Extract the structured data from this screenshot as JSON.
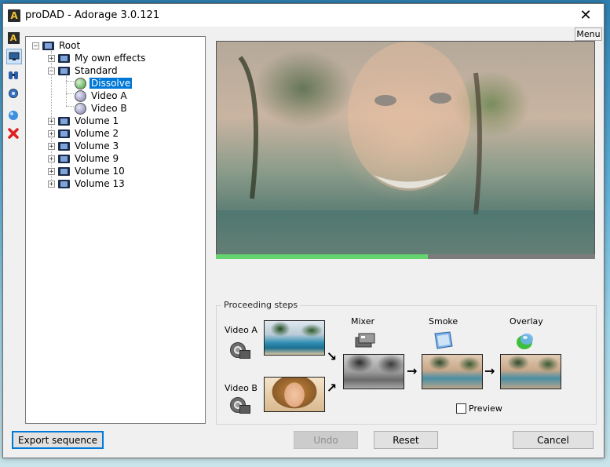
{
  "window": {
    "title": "proDAD - Adorage 3.0.121",
    "close": "✕",
    "menu_label": "Menu"
  },
  "tree": {
    "root": "Root",
    "my_effects": "My own effects",
    "standard": "Standard",
    "effects": [
      "Dissolve",
      "Video A",
      "Video B"
    ],
    "volumes": [
      "Volume 1",
      "Volume 2",
      "Volume 3",
      "Volume 9",
      "Volume 10",
      "Volume 13"
    ],
    "selected": "Dissolve"
  },
  "preview": {
    "progress_percent": 56
  },
  "steps": {
    "title": "Proceeding steps",
    "video_a": "Video A",
    "video_b": "Video B",
    "mixer": "Mixer",
    "smoke": "Smoke",
    "overlay": "Overlay",
    "preview_label": "Preview",
    "preview_checked": false
  },
  "buttons": {
    "export": "Export sequence",
    "undo": "Undo",
    "reset": "Reset",
    "cancel": "Cancel"
  },
  "icons": {
    "app": "adorage-logo-icon",
    "toolbar": [
      "adorage-logo-icon",
      "monitor-icon",
      "binoculars-icon",
      "gear-icon",
      "sphere-icon",
      "delete-icon"
    ]
  }
}
